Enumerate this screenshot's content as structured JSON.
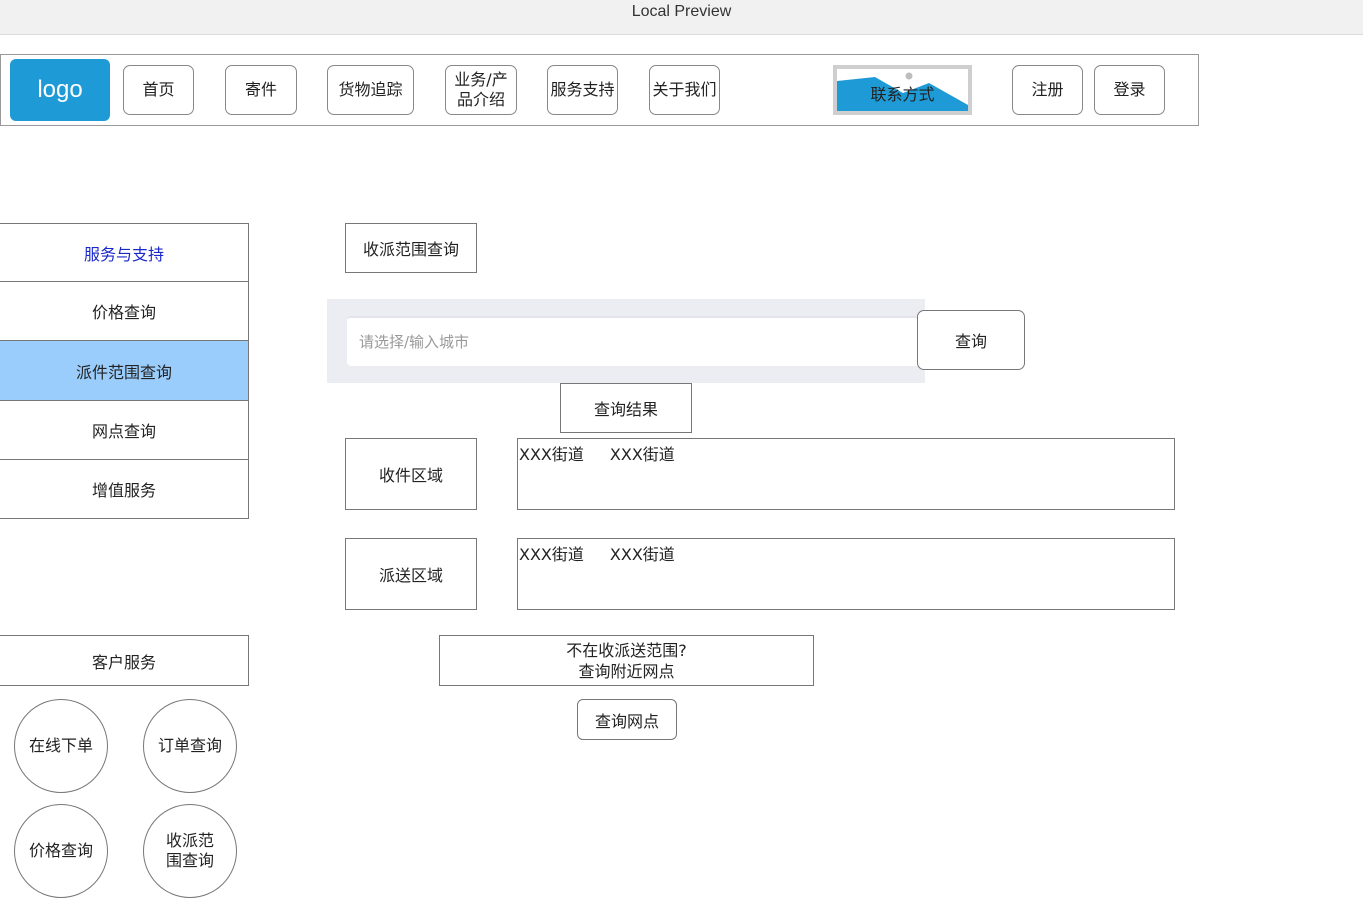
{
  "window": {
    "title": "Local Preview"
  },
  "header": {
    "logo": "logo",
    "nav": [
      {
        "label": "首页"
      },
      {
        "label": "寄件"
      },
      {
        "label": "货物追踪"
      },
      {
        "label": "业务/产\n品介绍"
      },
      {
        "label": "服务支持"
      },
      {
        "label": "关于我们"
      }
    ],
    "contact_label": "联系方式",
    "register": "注册",
    "login": "登录"
  },
  "sidebar": {
    "items": [
      {
        "label": "服务与支持"
      },
      {
        "label": "价格查询"
      },
      {
        "label": "派件范围查询"
      },
      {
        "label": "网点查询"
      },
      {
        "label": "增值服务"
      }
    ],
    "customer_service": "客户服务",
    "circles": [
      {
        "label": "在线下单"
      },
      {
        "label": "订单查询"
      },
      {
        "label": "价格查询"
      },
      {
        "label": "收派范\n围查询"
      }
    ]
  },
  "main": {
    "section_title": "收派范围查询",
    "search": {
      "placeholder": "请选择/输入城市",
      "value": "",
      "button": "查询"
    },
    "result_title": "查询结果",
    "pickup": {
      "label": "收件区域",
      "streets": [
        "XXX街道",
        "XXX街道"
      ]
    },
    "delivery": {
      "label": "派送区域",
      "streets": [
        "XXX街道",
        "XXX街道"
      ]
    },
    "notice_line1": "不在收派送范围?",
    "notice_line2": "查询附近网点",
    "outlet_button": "查询网点"
  },
  "colors": {
    "logo_bg": "#1e9bd7",
    "sidebar_active": "#9accfc",
    "sidebar_header_text": "#1a27c9",
    "search_bg": "#ececf3"
  }
}
